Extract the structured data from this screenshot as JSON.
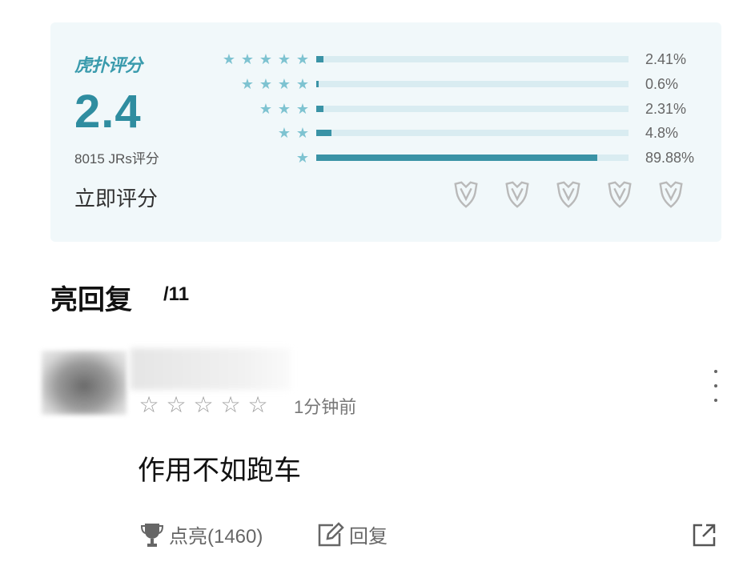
{
  "rating": {
    "brand": "虎扑评分",
    "score": "2.4",
    "count": "8015 JRs评分",
    "rate_now": "立即评分",
    "distribution": [
      {
        "stars": 5,
        "percent": "2.41%",
        "value": 2.41
      },
      {
        "stars": 4,
        "percent": "0.6%",
        "value": 0.6
      },
      {
        "stars": 3,
        "percent": "2.31%",
        "value": 2.31
      },
      {
        "stars": 2,
        "percent": "4.8%",
        "value": 4.8
      },
      {
        "stars": 1,
        "percent": "89.88%",
        "value": 89.88
      }
    ],
    "star_color": "#7ec3d1",
    "bar_color": "#3a93a6",
    "badge_count": 5
  },
  "section": {
    "title": "亮回复",
    "count": "/11"
  },
  "comment": {
    "user_stars": 5,
    "time": "1分钟前",
    "text": "作用不如跑车",
    "light_label": "点亮(1460)",
    "reply_label": "回复"
  }
}
